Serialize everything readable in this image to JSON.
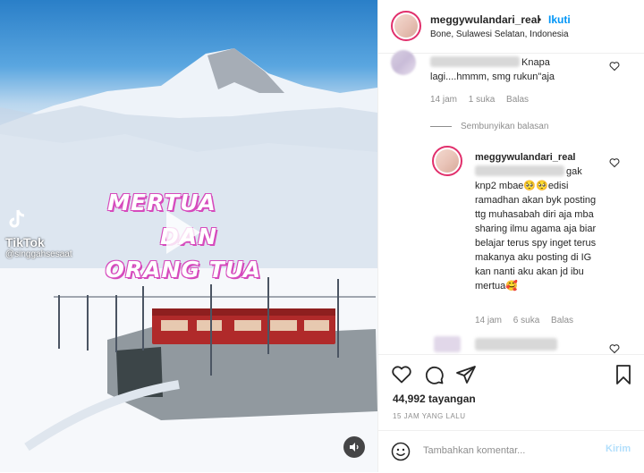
{
  "media": {
    "overlay_line1": "MERTUA",
    "overlay_line2": "DAN",
    "overlay_line3": "ORANG TUA",
    "watermark_brand": "TikTok",
    "watermark_handle": "@singgahsesaat"
  },
  "header": {
    "username": "meggywulandari_real",
    "separator": "•",
    "follow_label": "Ikuti",
    "location": "Bone, Sulawesi Selatan, Indonesia"
  },
  "comments": [
    {
      "text_after_name": "Knapa lagi....hmmm, smg rukun\"aja",
      "time": "14 jam",
      "likes": "1 suka",
      "reply": "Balas"
    }
  ],
  "hide_replies_label": "Sembunyikan balasan",
  "reply_comment": {
    "username": "meggywulandari_real",
    "text_after_mention": "gak knp2 mbae🥺🥺edisi ramadhan akan byk posting ttg muhasabah diri aja mba sharing ilmu agama aja biar belajar terus spy inget terus makanya aku posting di IG kan nanti aku akan jd ibu mertua🥰",
    "time": "14 jam",
    "likes": "6 suka",
    "reply": "Balas"
  },
  "post": {
    "views": "44,992 tayangan",
    "date": "15 JAM YANG LALU"
  },
  "composer": {
    "placeholder": "Tambahkan komentar...",
    "send_label": "Kirim"
  }
}
